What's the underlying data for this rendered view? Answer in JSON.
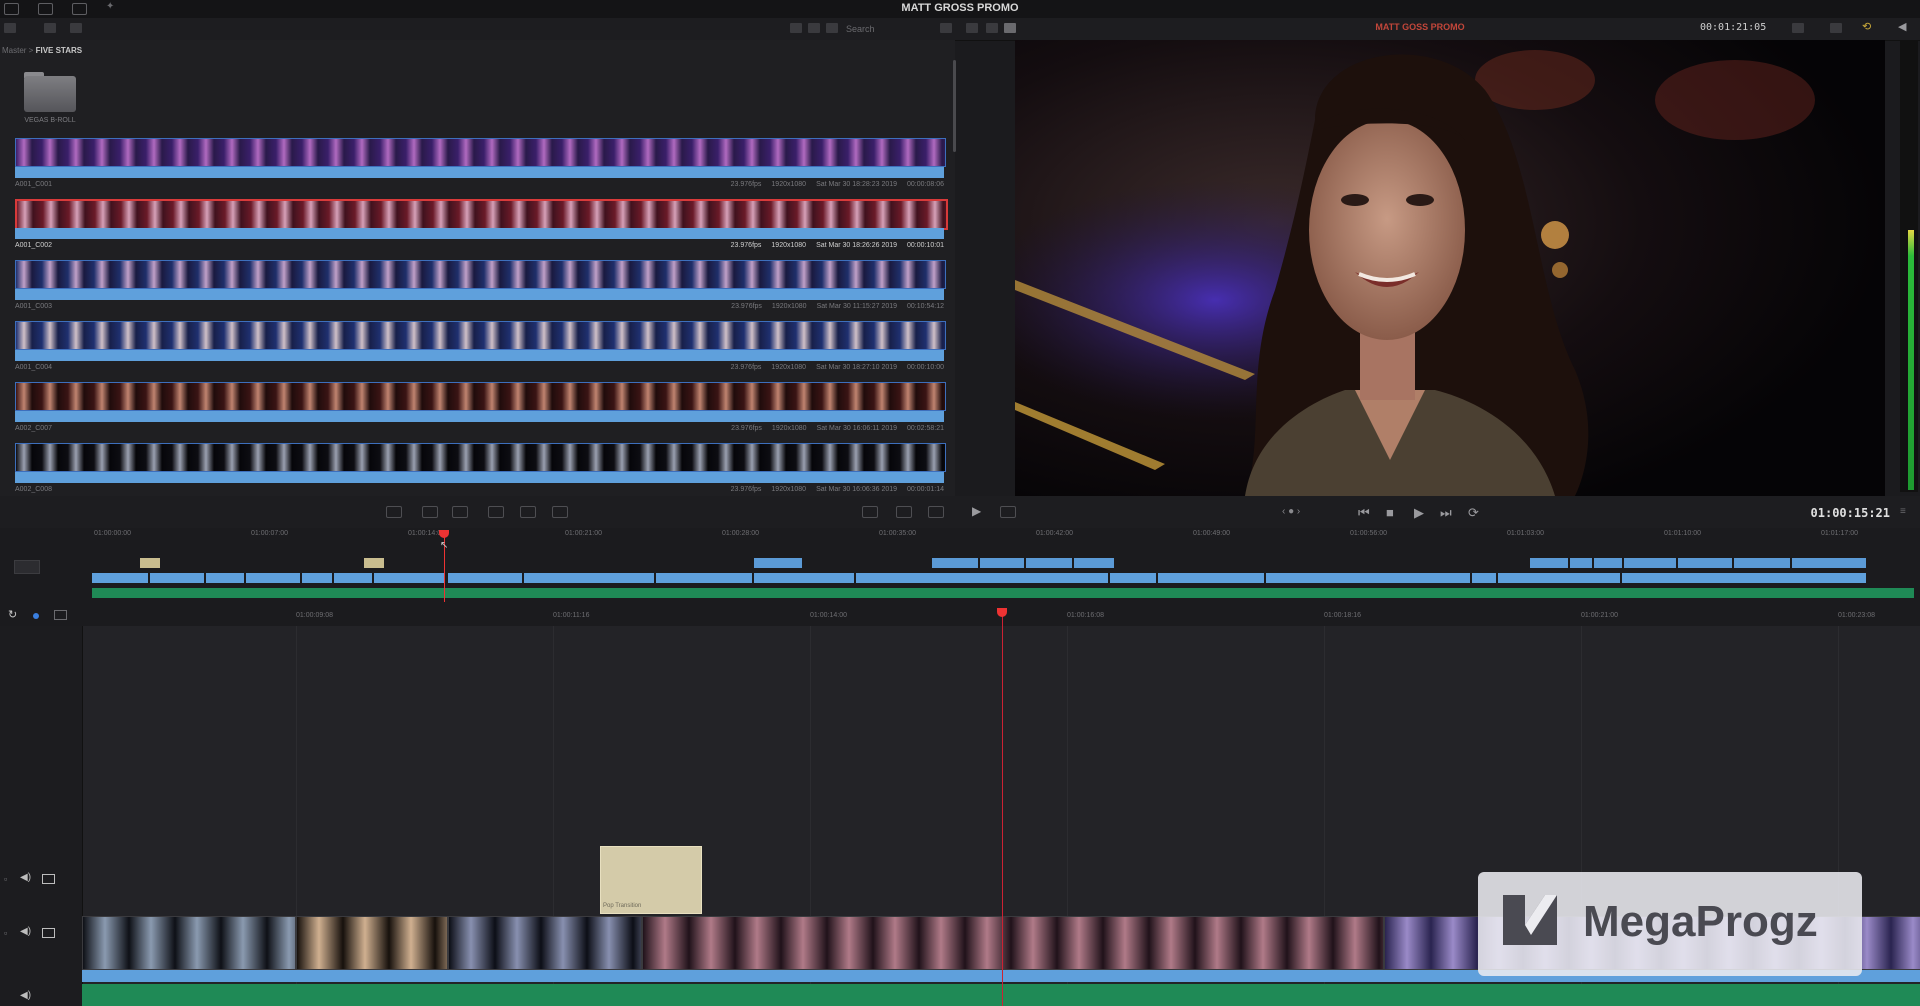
{
  "project_title": "MATT GROSS PROMO",
  "search": {
    "placeholder": "Search"
  },
  "breadcrumb": {
    "root": "Master",
    "current": "FIVE STARS"
  },
  "bin": {
    "name": "VEGAS B-ROLL"
  },
  "clips": [
    {
      "name": "A001_C001",
      "fps": "23.976fps",
      "res": "1920x1080",
      "date": "Sat Mar 30 18:28:23 2019",
      "duration": "00:00:08:06"
    },
    {
      "name": "A001_C002",
      "fps": "23.976fps",
      "res": "1920x1080",
      "date": "Sat Mar 30 18:26:26 2019",
      "duration": "00:00:10:01"
    },
    {
      "name": "A001_C003",
      "fps": "23.976fps",
      "res": "1920x1080",
      "date": "Sat Mar 30 11:15:27 2019",
      "duration": "00:10:54:12"
    },
    {
      "name": "A001_C004",
      "fps": "23.976fps",
      "res": "1920x1080",
      "date": "Sat Mar 30 18:27:10 2019",
      "duration": "00:00:10:00"
    },
    {
      "name": "A002_C007",
      "fps": "23.976fps",
      "res": "1920x1080",
      "date": "Sat Mar 30 16:06:11 2019",
      "duration": "00:02:58:21"
    },
    {
      "name": "A002_C008",
      "fps": "23.976fps",
      "res": "1920x1080",
      "date": "Sat Mar 30 16:06:36 2019",
      "duration": "00:00:01:14"
    }
  ],
  "viewer": {
    "name": "MATT GOSS PROMO",
    "timecode": "00:01:21:05"
  },
  "transport": {
    "timecode": "01:00:15:21"
  },
  "upper_ruler": [
    "01:00:00:00",
    "01:00:07:00",
    "01:00:14:00",
    "01:00:21:00",
    "01:00:28:00",
    "01:00:35:00",
    "01:00:42:00",
    "01:00:49:00",
    "01:00:56:00",
    "01:01:03:00",
    "01:01:10:00",
    "01:01:17:00"
  ],
  "lower_ruler": [
    "01:00:09:08",
    "01:00:11:16",
    "01:00:14:00",
    "01:00:16:08",
    "01:00:18:16",
    "01:00:21:00",
    "01:00:23:08"
  ],
  "title_clip": {
    "label": "Pop Transition"
  },
  "watermark": {
    "text": "MegaProgz"
  }
}
